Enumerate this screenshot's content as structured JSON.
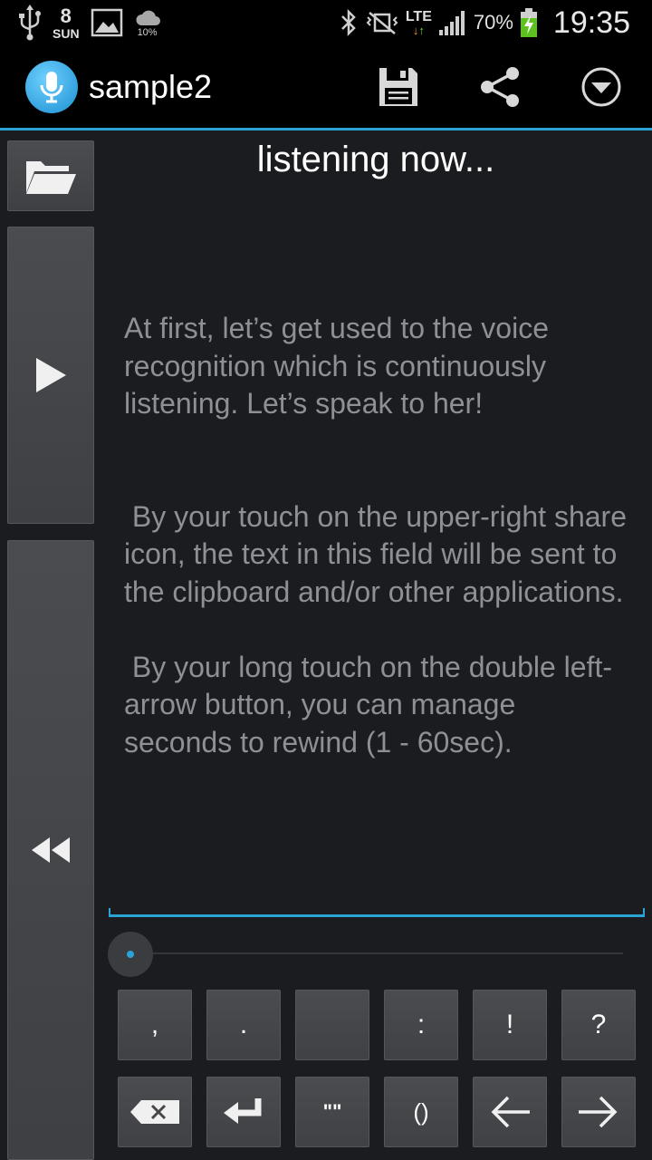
{
  "status_bar": {
    "date_day": "8",
    "date_weekday": "SUN",
    "weather_percent": "10%",
    "network": "LTE",
    "battery_percent": "70%",
    "time": "19:35"
  },
  "action_bar": {
    "title": "sample2"
  },
  "main": {
    "status_text": "listening now...",
    "body_text": "At first, let’s get used to the voice recognition which is continuously listening. Let’s speak to her!\n\n\n By your touch on the upper-right share icon, the text in this field will be sent to the clipboard and/or other applications.\n\n By your long touch on the double left-arrow button, you can manage seconds to rewind (1 - 60sec).",
    "seek_progress": 0
  },
  "keys": {
    "row1": [
      ",",
      ".",
      "",
      ":",
      "!",
      "?"
    ],
    "row2_quotes": "\"\"",
    "row2_parens": "()"
  },
  "colors": {
    "accent": "#2aa4d6",
    "background": "#1b1c1f",
    "button": "#45474b",
    "body_text": "#8e9094"
  }
}
